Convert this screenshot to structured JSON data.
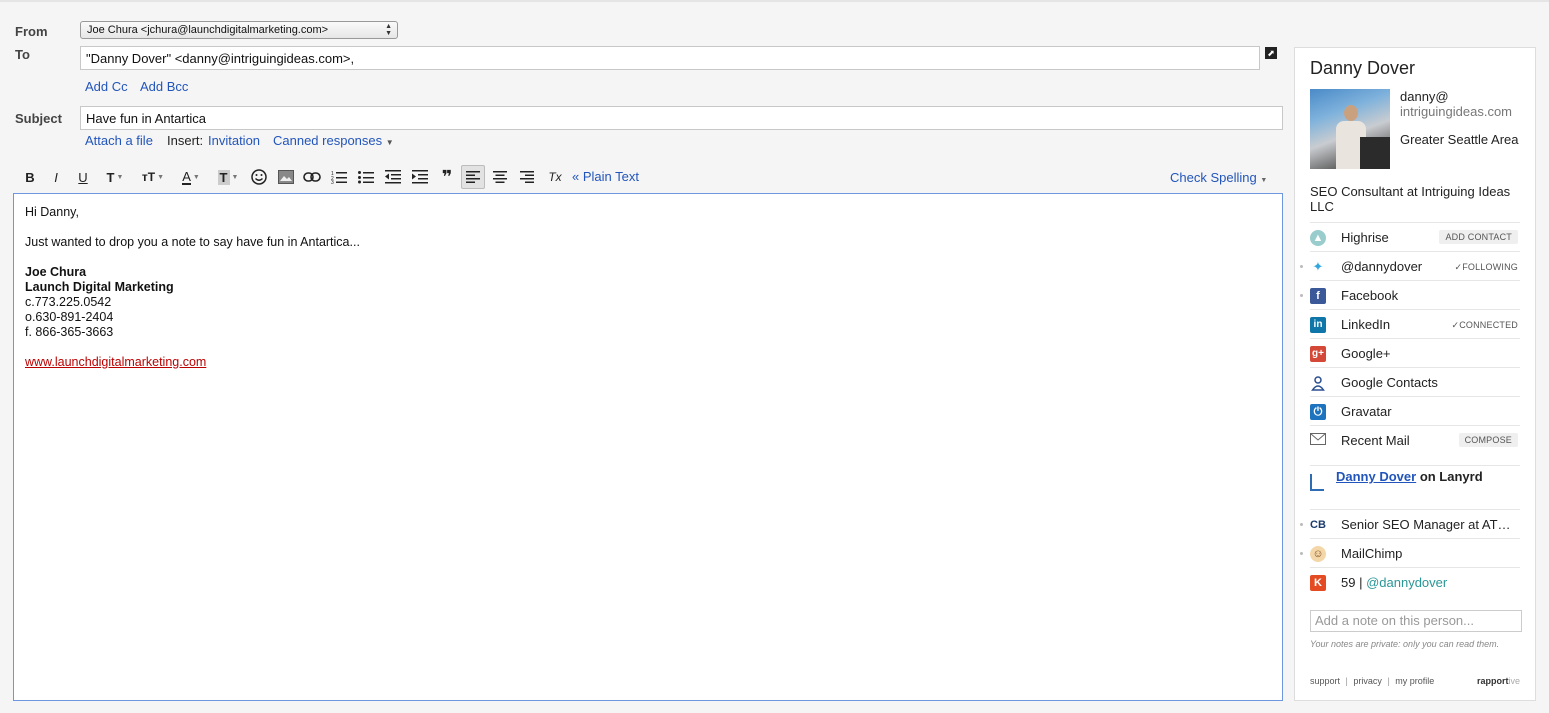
{
  "compose": {
    "from_label": "From",
    "from_value": "Joe Chura <jchura@launchdigitalmarketing.com>",
    "to_label": "To",
    "to_value": "\"Danny Dover\" <danny@intriguingideas.com>,",
    "add_cc": "Add Cc",
    "add_bcc": "Add Bcc",
    "subject_label": "Subject",
    "subject_value": "Have fun in Antartica",
    "attach": "Attach a file",
    "insert_label": "Insert:",
    "invitation": "Invitation",
    "canned": "Canned responses",
    "plain_text": "« Plain Text",
    "check_spelling": "Check Spelling"
  },
  "toolbar": {
    "bold": "B",
    "italic": "I",
    "underline": "U",
    "font": "T",
    "size": "тT",
    "color": "A",
    "highlight": "T",
    "clear": "Tx",
    "quote": "❞"
  },
  "body": {
    "greeting": "Hi Danny,",
    "line1": "Just wanted to drop you a note to say have fun in Antartica...",
    "sig_name": "Joe Chura",
    "sig_company": "Launch Digital Marketing",
    "sig_cell": "c.773.225.0542",
    "sig_office": "o.630-891-2404",
    "sig_fax": "f. 866-365-3663",
    "sig_link": "www.launchdigitalmarketing.com"
  },
  "sidebar": {
    "name": "Danny Dover",
    "email_user": "danny@",
    "email_domain": "intriguingideas.com",
    "location": "Greater Seattle Area",
    "title": "SEO Consultant at Intriguing Ideas LLC",
    "rows": [
      {
        "label": "Highrise",
        "badge": "ADD CONTACT"
      },
      {
        "label": "@dannydover",
        "badge": "✓FOLLOWING"
      },
      {
        "label": "Facebook",
        "badge": ""
      },
      {
        "label": "LinkedIn",
        "badge": "✓CONNECTED"
      },
      {
        "label": "Google+",
        "badge": ""
      },
      {
        "label": "Google Contacts",
        "badge": ""
      },
      {
        "label": "Gravatar",
        "badge": ""
      },
      {
        "label": "Recent Mail",
        "badge": "COMPOSE"
      }
    ],
    "lanyrd_name": "Danny Dover",
    "lanyrd_suffix": " on Lanyrd",
    "rows2": [
      {
        "label": "Senior SEO Manager at AT…"
      },
      {
        "label": "MailChimp"
      }
    ],
    "klout_score": "59",
    "klout_sep": " | ",
    "klout_handle": "@dannydover",
    "note_placeholder": "Add a note on this person...",
    "private_text": "Your notes are private: only you can read them.",
    "footer": {
      "support": "support",
      "privacy": "privacy",
      "profile": "my profile",
      "sep": "|"
    },
    "brand_main": "rapport",
    "brand_suffix": "ive"
  },
  "colors": {
    "link": "#2255bb",
    "editor_border": "#6f97e0",
    "signature_link": "#bb0000"
  }
}
